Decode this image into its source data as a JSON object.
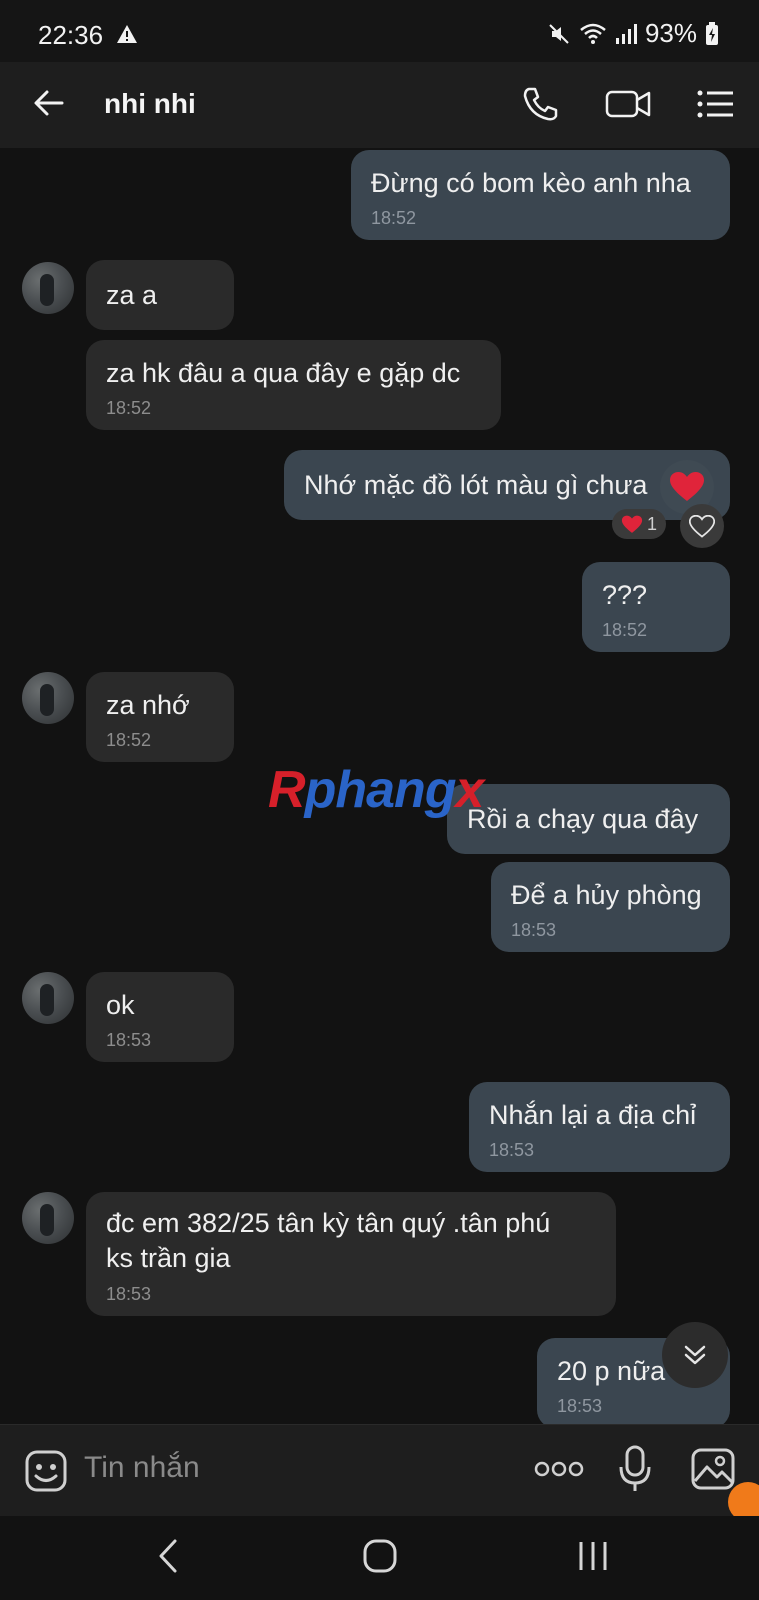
{
  "status_bar": {
    "time": "22:36",
    "battery": "93%",
    "icons": [
      "warning-icon",
      "mute-icon",
      "wifi-icon",
      "signal-icon",
      "battery-icon"
    ]
  },
  "header": {
    "title": "nhi nhi",
    "icons": [
      "back-arrow-icon",
      "phone-icon",
      "video-call-icon",
      "menu-list-icon"
    ]
  },
  "messages": [
    {
      "dir": "out",
      "text": "Đừng có bom kèo anh nha",
      "time": "18:52"
    },
    {
      "dir": "in",
      "text": "za a",
      "time": ""
    },
    {
      "dir": "in",
      "text": "za hk đâu a qua đây e gặp dc",
      "time": "18:52"
    },
    {
      "dir": "out",
      "text": "Nhớ mặc đồ lót màu gì chưa",
      "time": "",
      "reaction_count": "1"
    },
    {
      "dir": "out",
      "text": "???",
      "time": "18:52"
    },
    {
      "dir": "in",
      "text": "za nhớ",
      "time": "18:52"
    },
    {
      "dir": "out",
      "text": "Rồi a chạy qua đây",
      "time": ""
    },
    {
      "dir": "out",
      "text": "Để a hủy phòng",
      "time": "18:53"
    },
    {
      "dir": "in",
      "text": "ok",
      "time": "18:53"
    },
    {
      "dir": "out",
      "text": "Nhắn lại a địa chỉ",
      "time": "18:53"
    },
    {
      "dir": "in",
      "text": "đc em 382/25 tân kỳ tân quý .tân phú\nks trần gia",
      "time": "18:53"
    },
    {
      "dir": "out",
      "text": "20 p nữa",
      "time": "18:53"
    }
  ],
  "watermark": {
    "part1": "R",
    "part2": "phang",
    "part3": "x"
  },
  "composer": {
    "placeholder": "Tin nhắn",
    "icons": [
      "sticker-icon",
      "more-dots-icon",
      "microphone-icon",
      "image-icon"
    ]
  },
  "colors": {
    "outgoing_bubble": "#3b4650",
    "incoming_bubble": "#2a2a2a",
    "background": "#121212",
    "reaction_heart": "#e0243a"
  }
}
